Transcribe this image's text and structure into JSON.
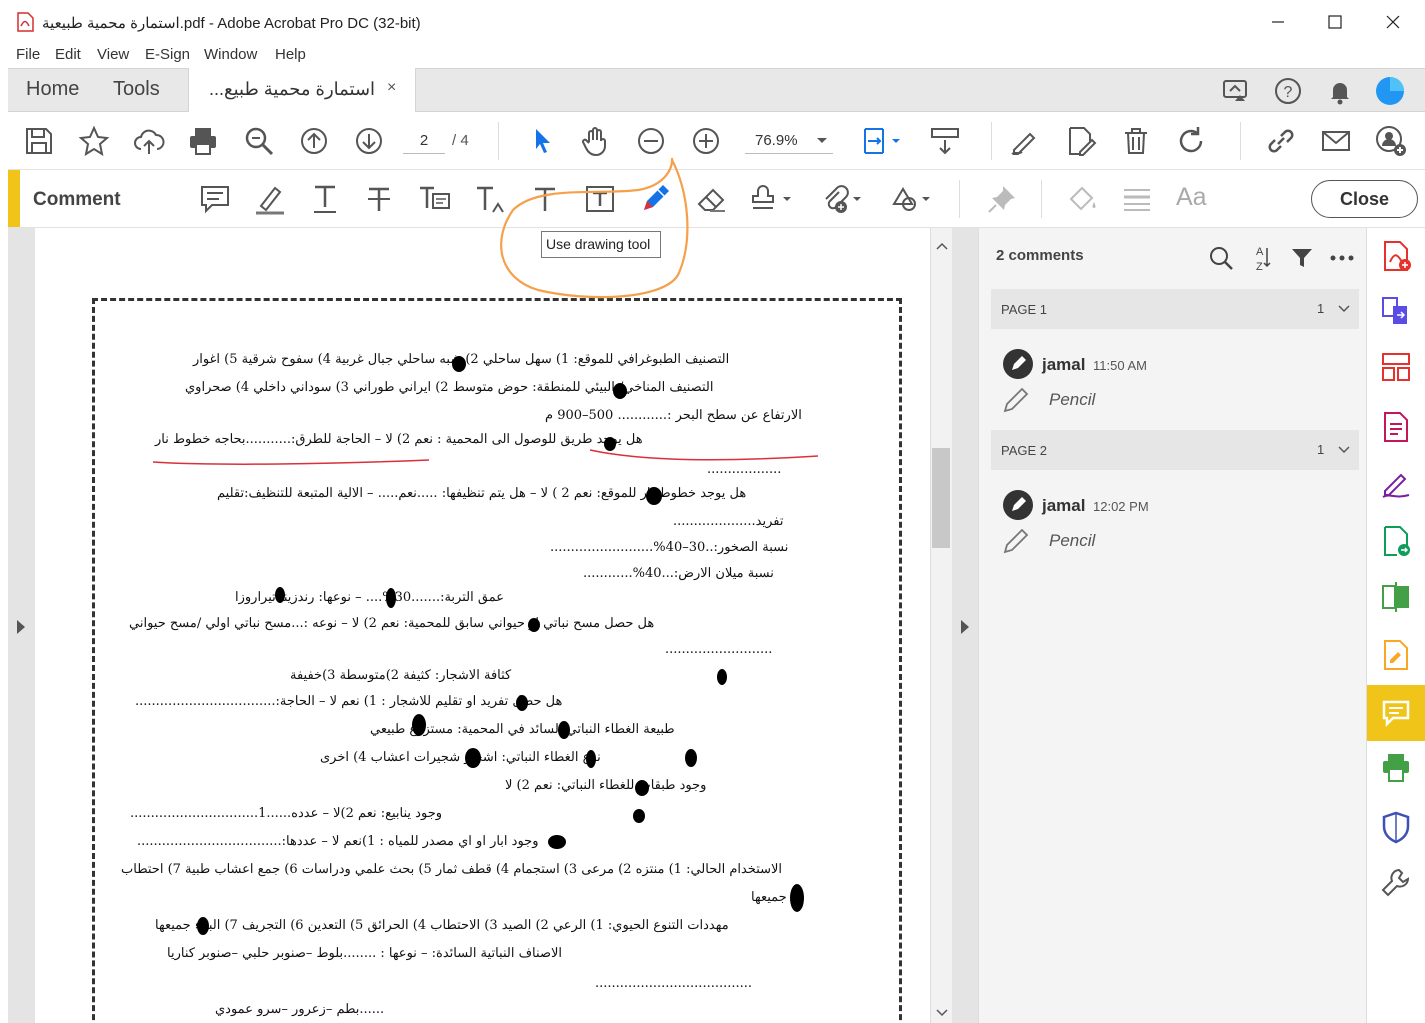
{
  "window": {
    "title": "استمارة محمية طبيعية.pdf - Adobe Acrobat Pro DC (32-bit)"
  },
  "menu": [
    "File",
    "Edit",
    "View",
    "E-Sign",
    "Window",
    "Help"
  ],
  "tabs": {
    "home": "Home",
    "tools": "Tools",
    "document": "استمارة محمية طبيع...",
    "close_glyph": "×"
  },
  "toolbar": {
    "page_current": "2",
    "page_total": "/ 4",
    "zoom": "76.9%"
  },
  "comment_bar": {
    "label": "Comment",
    "close_label": "Close",
    "font_label": "Aa"
  },
  "tooltip": "Use drawing tool",
  "comments_panel": {
    "count_label": "2 comments",
    "groups": [
      {
        "page_label": "PAGE 1",
        "count": "1",
        "author": "jamal",
        "time": "11:50 AM",
        "type": "Pencil"
      },
      {
        "page_label": "PAGE 2",
        "count": "1",
        "author": "jamal",
        "time": "12:02 PM",
        "type": "Pencil"
      }
    ]
  },
  "form_lines": [
    "التصنيف الطبوغرافي للموقع: 1) سهل ساحلي   2) شبه ساحلي   جبال غربية   4) سفوح شرقية   5) اغوار",
    "التصنيف المناخي/ البيئي للمنطقة: حوض متوسط   2) ايراني طوراني   3) سوداني داخلي   4) صحراوي",
    "الارتفاع عن سطح البحر :............ 500–900 م",
    "هل يوجد طريق للوصول الى المحمية : نعم   2) لا   – الحاجة للطرق:...........بحاجه خطوط نار",
    "..................",
    "هل يوجد خطوط نار للموقع: نعم  2 ) لا   – هل يتم تنظيفها: .....نعم.....   – الالية المتبعة للتنظيف:تقليم",
    "تفريد....................",
    "نسبة الصخور:..30–40%.........................",
    "نسبة ميلان الارض:...40%............",
    "عمق التربة:.......30%....   – نوعها:   رندزينا   تيراروزا",
    "هل حصل مسح نباتي او حيواني سابق للمحمية: نعم   2) لا   – نوعه :...مسح نباتي اولي /مسح حيواني",
    "..........................",
    "كثافة الاشجار: كثيفة   2)متوسطة   3)خفيفة",
    "هل حصل تفريد او تقليم للاشجار : 1) نعم   لا   – الحاجة:..................................",
    "طبيعة الغطاء النباتي السائد في المحمية: مستزرع   طبيعي",
    "نوع الغطاء النباتي: اشجار   شجيرات   اعشاب   4) اخرى",
    "وجود طبقات للغطاء النباتي: نعم   2) لا",
    "وجود ينابيع: نعم   2)لا   – عدده......1...............................",
    "وجود ابار او اي مصدر للمياه : 1)نعم   لا   – عددها:...................................",
    "الاستخدام الحالي: 1) منتزه  2) مرعى 3) استجمام 4) قطف ثمار 5) بحث علمي ودراسات 6) جمع اعشاب طبية 7) احتطاب",
    "جميعها",
    "مهددات التنوع الحيوي: 1) الرعي  2) الصيد  3) الاحتطاب  4) الحرائق  5) التعدين  6) التجريف  7) البناء  جميعها",
    "الاصناف النباتية السائدة:   – نوعها : ........بلوط –صنوبر حلبي –صنوبر كناريا",
    "......................................",
    "......بطم –زعرور –سرو عمودي"
  ],
  "colors": {
    "accent_yellow": "#f0c419",
    "annotation_orange": "#f5a04a",
    "underline_red": "#d9303a",
    "tool_blue": "#1473e6"
  }
}
